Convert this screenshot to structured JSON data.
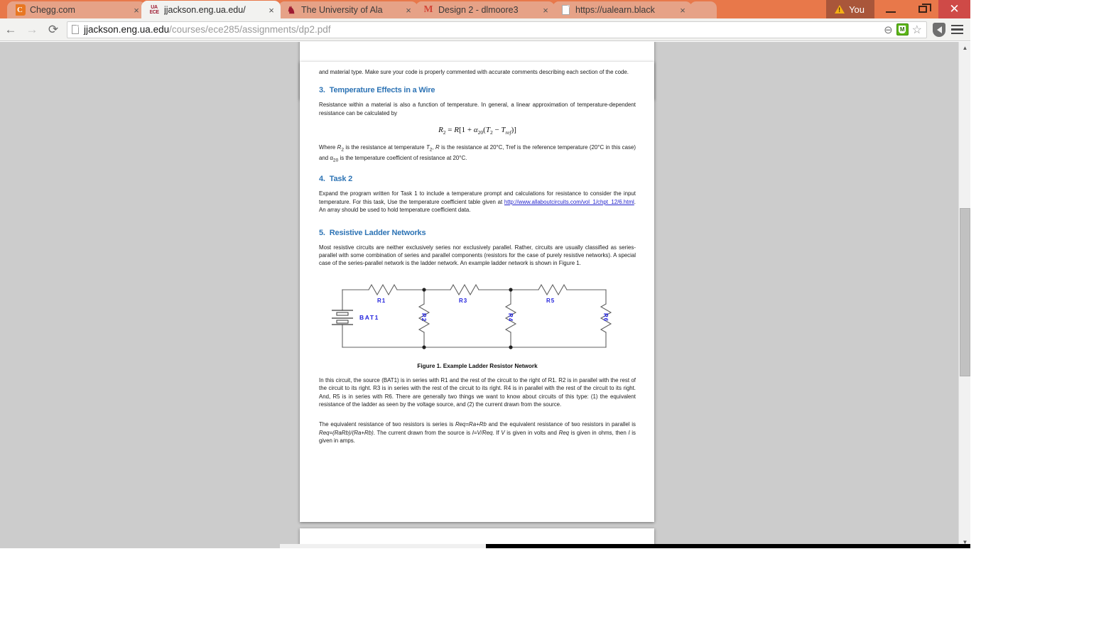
{
  "browser": {
    "tabs": [
      {
        "title": "Chegg.com",
        "favicon": "chegg-logo-icon",
        "active": false,
        "close_label": "×"
      },
      {
        "title": "jjackson.eng.ua.edu/",
        "favicon": "ua-ece-logo-icon",
        "active": true,
        "close_label": "×"
      },
      {
        "title": "The University of Ala",
        "favicon": "ua-elephant-icon",
        "active": false,
        "close_label": "×"
      },
      {
        "title": "Design 2 - dlmoore3",
        "favicon": "gmail-icon",
        "active": false,
        "close_label": "×"
      },
      {
        "title": "https://ualearn.black",
        "favicon": "generic-page-icon",
        "active": false,
        "close_label": "×"
      }
    ],
    "user_chip": "You",
    "window_controls": {
      "minimize": "—",
      "maximize": "❐",
      "close": "✕"
    },
    "nav": {
      "back": "←",
      "forward": "→",
      "reload": "⟳",
      "url_host": "jjackson.eng.ua.edu",
      "url_path": "/courses/ece285/assignments/dp2.pdf",
      "url_full": "jjackson.eng.ua.edu/courses/ece285/assignments/dp2.pdf",
      "icons": [
        "zoom-out-icon",
        "mcafee-siteadvisor-icon",
        "bookmark-star-icon",
        "shield-icon",
        "menu-icon"
      ],
      "mcafee_letter": "M",
      "zoom_out_glyph": "⊖",
      "star_glyph": "☆"
    },
    "scrollbar": {
      "up_arrow": "▲",
      "down_arrow": "▼"
    }
  },
  "document": {
    "intro_paragraph": "and material type. Make sure your code is properly commented with accurate comments describing each section of the code.",
    "sections": [
      {
        "number": "3.",
        "heading": "Temperature Effects in a Wire",
        "body": "Resistance within a material is also a function of temperature. In general, a linear approximation of temperature-dependent resistance can be calculated by",
        "formula": "R₂ = R[1 + α₂₀(T₂ − T_ref)]",
        "after_formula": "Where R2 is the resistance at temperature T2, R is the resistance at 20°C, Tref is the reference temperature (20°C in this case) and α20 is the temperature coefficient of resistance at 20°C."
      },
      {
        "number": "4.",
        "heading": "Task 2",
        "body_part1": "Expand the program written for Task 1 to include a temperature prompt and calculations for resistance to consider the input temperature. For this task, Use the temperature coefficient table given at ",
        "link_text": "http://www.allaboutcircuits.com/vol_1/chpt_12/6.html",
        "body_part2": ". An array should be used to hold temperature coefficient data."
      },
      {
        "number": "5.",
        "heading": "Resistive Ladder Networks",
        "body": "Most resistive circuits are neither exclusively series nor exclusively parallel. Rather, circuits are usually classified as series-parallel with some combination of series and parallel components (resistors for the case of purely resistive networks). A special case of the series-parallel network is the ladder network. An example ladder network is shown in Figure 1."
      }
    ],
    "figure": {
      "caption": "Figure 1. Example Ladder Resistor Network",
      "source_label": "BAT1",
      "resistor_labels": [
        "R1",
        "R2",
        "R3",
        "R4",
        "R5",
        "R6"
      ],
      "label_color": "#2222dd",
      "wire_color": "#606060"
    },
    "after_figure_paragraph": "In this circuit, the source (BAT1) is in series with R1 and the rest of the circuit to the right of R1. R2 is in parallel with the rest of the circuit to its right. R3 is in series with the rest of the circuit to its right. R4 is in parallel with the rest of the circuit to its right. And, R5 is in series with R6. There are generally two things we want to know about circuits of this type: (1) the equivalent resistance of the ladder as seen by the voltage source, and (2) the current drawn from the source.",
    "equations_paragraph_parts": {
      "a": "The equivalent resistance of two resistors is series is ",
      "eq1": "Req=Ra+Rb",
      "b": " and the equivalent resistance of two resistors in parallel is ",
      "eq2": "Req=(RaRb)/(Ra+Rb)",
      "c": ". The current drawn from the source is ",
      "eq3": "I=V/Req",
      "d": ". If ",
      "e": "V",
      "f": " is given in volts and ",
      "eq4": "Req",
      "g": " is given in ohms, then ",
      "h": "I",
      "i": " is given in amps."
    }
  },
  "colors": {
    "chrome_orange": "#e8784a",
    "tab_inactive": "#e6a287",
    "tab_active": "#f2f2f0",
    "close_red": "#cf4a47",
    "heading_blue": "#2e74b5",
    "viewer_gray": "#cccccc"
  }
}
